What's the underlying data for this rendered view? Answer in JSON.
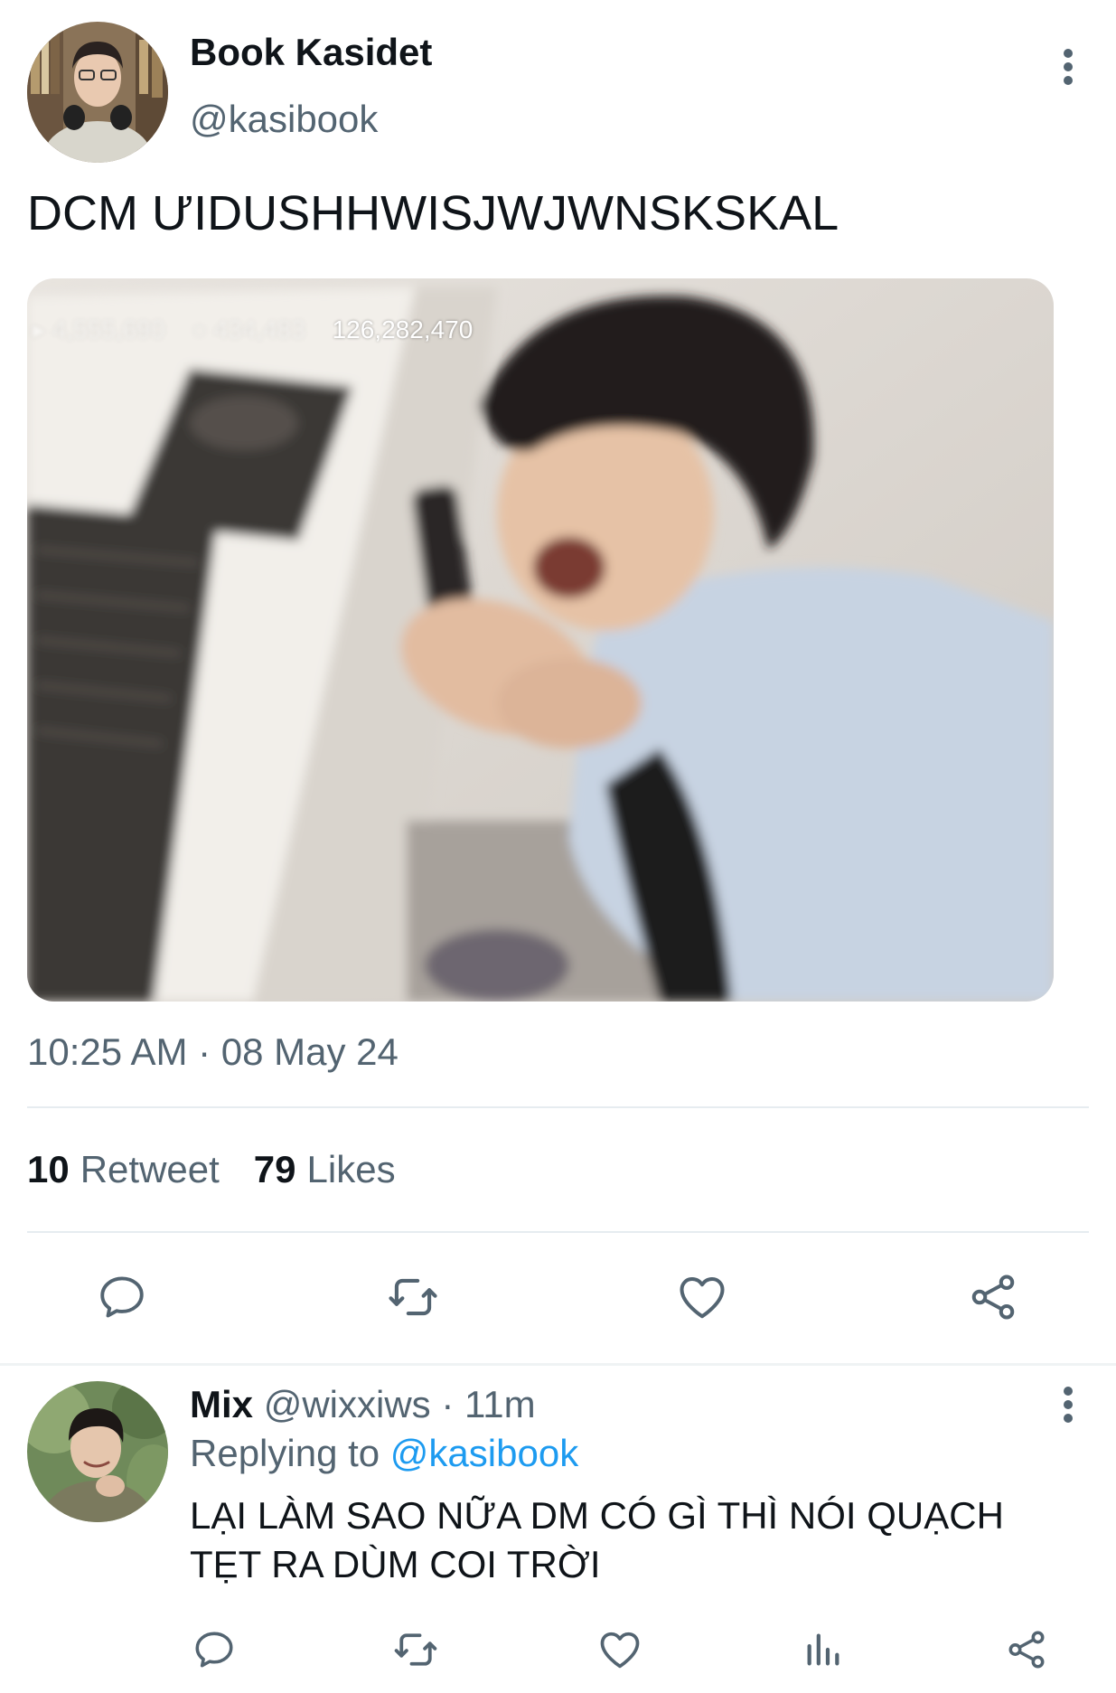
{
  "tweet": {
    "author": {
      "name": "Book Kasidet",
      "handle": "@kasibook"
    },
    "text": "DCM ƯIDUSHHWISJWJWNSKSKAL",
    "media": {
      "overlay_counter": "126,282,470"
    },
    "timestamp": "10:25 AM · 08 May 24",
    "stats": {
      "retweets_count": "10",
      "retweets_label": "Retweet",
      "likes_count": "79",
      "likes_label": "Likes"
    },
    "actions": [
      "reply-icon",
      "retweet-icon",
      "heart-icon",
      "share-icon"
    ]
  },
  "reply": {
    "author_name": "Mix",
    "meta": "@wixxiws · 11m",
    "replying_prefix": "Replying to",
    "replying_handle": "@kasibook",
    "text": "LẠI LÀM SAO NỮA DM CÓ GÌ THÌ NÓI QUẠCH TẸT RA DÙM COI TRỜI",
    "actions": [
      "reply-icon",
      "retweet-icon",
      "heart-icon",
      "analytics-icon",
      "share-icon"
    ]
  },
  "colors": {
    "text_primary": "#0f1419",
    "text_secondary": "#536471",
    "link": "#1d9bf0",
    "icon": "#536471",
    "divider": "#e6ecf0"
  }
}
